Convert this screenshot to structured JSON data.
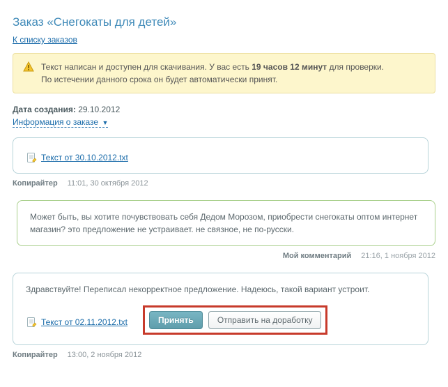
{
  "page": {
    "title": "Заказ «Снегокаты для детей»",
    "back_link": "К списку заказов"
  },
  "notice": {
    "line1_pre": "Текст написан и доступен для скачивания. У вас есть ",
    "bold": "19 часов 12 минут",
    "line1_post": " для проверки.",
    "line2": "По истечении данного срока он будет автоматически принят."
  },
  "meta": {
    "created_label": "Дата создания:",
    "created_value": "29.10.2012",
    "info_link": "Информация о заказе"
  },
  "thread": [
    {
      "side": "left",
      "role": "Копирайтер",
      "timestamp": "11:01, 30 октября 2012",
      "file": "Текст от 30.10.2012.txt"
    },
    {
      "side": "right",
      "role": "Мой комментарий",
      "timestamp": "21:16, 1 ноября 2012",
      "text": "Может быть, вы хотите почувствовать себя Дедом Морозом, приобрести снегокаты оптом интернет магазин? это предложение не устраивает. не связное, не по-русски."
    },
    {
      "side": "left",
      "role": "Копирайтер",
      "timestamp": "13:00, 2 ноября 2012",
      "text": "Здравствуйте! Переписал некорректное предложение. Надеюсь, такой вариант устроит.",
      "file": "Текст от 02.11.2012.txt"
    }
  ],
  "buttons": {
    "accept": "Принять",
    "rework": "Отправить на доработку"
  }
}
